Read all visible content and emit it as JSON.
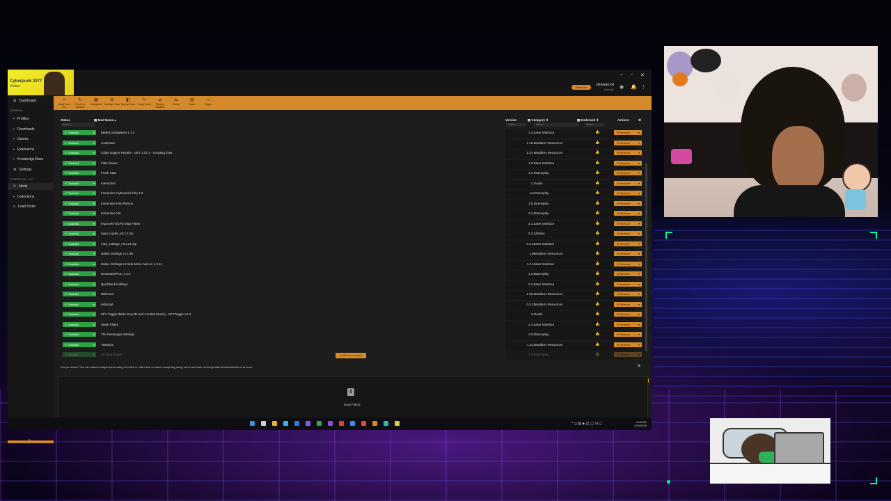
{
  "app": {
    "logo_line1": "Cyberpunk 2077",
    "logo_line2": "Vortex",
    "username": "chiwwarrioll",
    "user_sub": "Log out",
    "premium": "Premium"
  },
  "toolbar": [
    {
      "icon": "+",
      "label": "Install From File"
    },
    {
      "icon": "↻",
      "label": "Check for Updates"
    },
    {
      "icon": "▦",
      "label": "Categories"
    },
    {
      "icon": "⚙",
      "label": "Manage Rules"
    },
    {
      "icon": "◧",
      "label": "Deploy Mods"
    },
    {
      "icon": "✎",
      "label": "Purge Mods"
    },
    {
      "icon": "⇄",
      "label": "Restore Installed"
    },
    {
      "icon": "⇆",
      "label": "Share"
    },
    {
      "icon": "▤",
      "label": "Open"
    },
    {
      "icon": "▭",
      "label": "Toggle"
    }
  ],
  "sidebar": {
    "items_top": [
      {
        "icon": "☰",
        "label": "Dashboard"
      }
    ],
    "section_general": "GENERAL",
    "items_general": [
      {
        "icon": "▪",
        "label": "Profiles"
      },
      {
        "icon": "▪",
        "label": "Downloads"
      },
      {
        "icon": "▪",
        "label": "Games"
      },
      {
        "icon": "▪",
        "label": "Extensions"
      },
      {
        "icon": "▪",
        "label": "Knowledge Base"
      },
      {
        "icon": "⚙",
        "label": "Settings"
      }
    ],
    "section_game": "CYBERPUNK 2077",
    "items_game": [
      {
        "icon": "✎",
        "label": "Mods"
      },
      {
        "icon": "▪",
        "label": "Collections"
      },
      {
        "icon": "≡",
        "label": "Load Order"
      }
    ]
  },
  "table": {
    "headers": {
      "status": "Status",
      "name": "Mod Name",
      "version": "Version",
      "category": "Category",
      "endorsed": "Endorsed",
      "actions": "Actions"
    },
    "filter_placeholder": "Select...",
    "status_label": "Enabled",
    "action_label": "Remove",
    "rows": [
      {
        "name": "BetterLootMarkers-1.3.2",
        "version": "1.3.2",
        "category": "User Interface"
      },
      {
        "name": "Codeware",
        "version": "1.18.1",
        "category": "Modders Resources"
      },
      {
        "name": "Cyber Engine Tweaks - CET 1.37.1 - Scripting fixes",
        "version": "1.37.1",
        "category": "Modders Resources"
      },
      {
        "name": "Filter Saves",
        "version": "1.0.2",
        "category": "User Interface"
      },
      {
        "name": "Fresh Start",
        "version": "1.4.7",
        "category": "Gameplay"
      },
      {
        "name": "Interaction",
        "version": "1.1",
        "category": "Audio"
      },
      {
        "name": "Immersive Cyberpunk City 2.3",
        "version": "unv.",
        "category": "Gameplay"
      },
      {
        "name": "Immersive First Person",
        "version": "1.5.1",
        "category": "Gameplay"
      },
      {
        "name": "Immersive VN",
        "version": "2.1.0",
        "category": "Gameplay"
      },
      {
        "name": "Improved NCPD Map Filters",
        "version": "2.1.1",
        "category": "User Interface"
      },
      {
        "name": "input_loader_v0.2.3.zip",
        "version": "0.2.3",
        "category": "Utilities"
      },
      {
        "name": "mod_settings_v0.2.21.zip",
        "version": "0.2.21",
        "category": "User Interface"
      },
      {
        "name": "Native Settings UI 1.96",
        "version": "1.96",
        "category": "Modders Resources"
      },
      {
        "name": "Native Settings UI Side Menu Add-on 1.3.11",
        "version": "1.3.11",
        "category": "User Interface"
      },
      {
        "name": "NewGamePlus_1.3.0",
        "version": "1.3.0",
        "category": "Gameplay"
      },
      {
        "name": "Quickhack Hotkeys",
        "version": "2.3.1",
        "category": "User Interface"
      },
      {
        "name": "RED4ext",
        "version": "1.29.1",
        "category": "Modders Resources"
      },
      {
        "name": "redscript",
        "version": "0.5.31",
        "category": "Modders Resources"
      },
      {
        "name": "SFX Toggle (Mute Sounds and Combat Music) - SFXToggle V1.3",
        "version": "1.3",
        "category": "Audio"
      },
      {
        "name": "Stash Filters",
        "version": "2.3.2",
        "category": "User Interface"
      },
      {
        "name": "The Passenger Settings",
        "version": "2.0.0",
        "category": "Gameplay"
      },
      {
        "name": "TweakXL",
        "version": "1.11.3",
        "category": "Modders Resources"
      },
      {
        "name": "Window Range",
        "version": "2.0.0",
        "category": "Gameplay"
      }
    ]
  },
  "get_more": "Get more mods",
  "tip": "Did you know? You can select multiple items using ctrl+click or shift+click or select everything using ctrl+a and then do things with all selected items at once.",
  "drop_label": "Drop File(s)",
  "clock": {
    "time": "2:00 AM",
    "date": "1/24/2026"
  },
  "colors": {
    "accent": "#d48a2a",
    "enabled": "#2ca345",
    "window_bg": "#1c1c1c"
  }
}
